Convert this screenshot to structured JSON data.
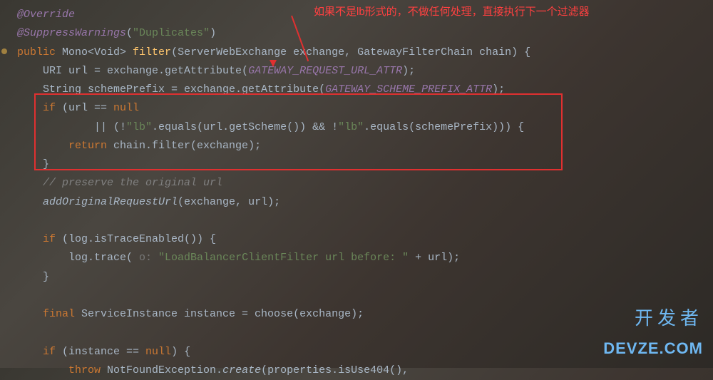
{
  "commentary": "如果不是lb形式的，不做任何处理，直接执行下一个过滤器",
  "code": {
    "l1_override": "@Override",
    "l2_suppress": "@SuppressWarnings",
    "l2_open": "(",
    "l2_str": "\"Duplicates\"",
    "l2_close": ")",
    "l3_public": "public",
    "l3_type": " Mono<Void> ",
    "l3_method": "filter",
    "l3_params": "(ServerWebExchange exchange, GatewayFilterChain chain) {",
    "l4": "    URI url = exchange.getAttribute(",
    "l4_const": "GATEWAY_REQUEST_URL_ATTR",
    "l4_end": ");",
    "l5": "    String schemePrefix = exchange.getAttribute(",
    "l5_const": "GATEWAY_SCHEME_PREFIX_ATTR",
    "l5_end": ");",
    "l6_if": "    if",
    "l6_rest": " (url == ",
    "l6_null": "null",
    "l7_a": "            || (!",
    "l7_s1": "\"lb\"",
    "l7_b": ".equals(url.getScheme()) && !",
    "l7_s2": "\"lb\"",
    "l7_c": ".equals(schemePrefix))) {",
    "l8_ret": "        return",
    "l8_rest": " chain.filter(exchange);",
    "l9": "    }",
    "l10": "    // preserve the original url",
    "l11_m": "    addOriginalRequestUrl",
    "l11_rest": "(exchange, url);",
    "l12": " ",
    "l13_if": "    if",
    "l13_rest": " (log.isTraceEnabled()) {",
    "l14_a": "        log.trace( ",
    "l14_hint": "o: ",
    "l14_str": "\"LoadBalancerClientFilter url before: \"",
    "l14_end": " + url);",
    "l15": "    }",
    "l16": " ",
    "l17_final": "    final",
    "l17_rest": " ServiceInstance instance = choose(exchange);",
    "l18": " ",
    "l19_if": "    if",
    "l19_a": " (instance == ",
    "l19_null": "null",
    "l19_b": ") {",
    "l20_throw": "        throw",
    "l20_a": " NotFoundException.",
    "l20_create": "create",
    "l20_b": "(properties.isUse404(),"
  },
  "watermark": {
    "cn": "开发者",
    "en": "DEVZE.COM"
  }
}
